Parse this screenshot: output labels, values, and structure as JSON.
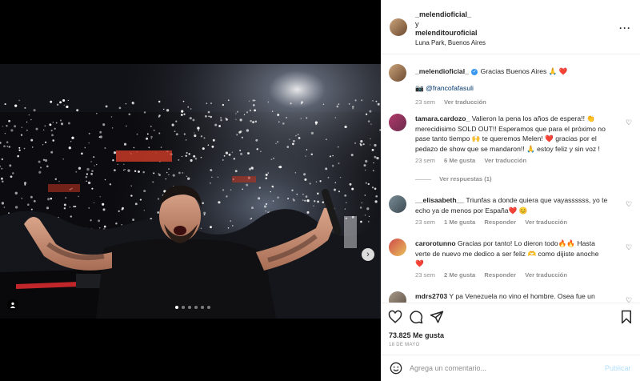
{
  "post": {
    "header": {
      "user1": "_melendioficial_",
      "joiner": "y",
      "user2": "melenditouroficial",
      "location": "Luna Park, Buenos Aires"
    },
    "caption": {
      "user": "_melendioficial_",
      "text": "Gracias Buenos Aires 🙏 ❤️",
      "credit_prefix": "📷",
      "credit_user": "@francofafasuli",
      "age": "23 sem",
      "translate": "Ver traducción"
    },
    "comments": [
      {
        "user": "tamara.cardozo_",
        "lines": [
          "Valieron la pena los años de espera!! 👏",
          "merecidisimo SOLD OUT!! Esperamos que para el próximo no",
          "pase tanto tiempo 🙌 te queremos Melen! ❤️ gracias por el",
          "pedazo de show que se mandaron!! 🙏 estoy feliz y sin voz !"
        ],
        "age": "23 sem",
        "likes": "6 Me gusta",
        "translate": "Ver traducción",
        "replies": "Ver respuestas (1)"
      },
      {
        "user": "__elisaabeth__",
        "lines": [
          "Triunfas a donde quiera que vayassssss, yo te",
          "echo ya de menos por España❤️ 😊"
        ],
        "age": "23 sem",
        "likes": "1 Me gusta",
        "reply": "Responder",
        "translate": "Ver traducción"
      },
      {
        "user": "carorotunno",
        "lines": [
          "Gracias por tanto! Lo dieron todo🔥🔥 Hasta",
          "verte de nuevo me dedico a ser feliz 🫶 como dijiste anoche",
          "❤️"
        ],
        "age": "23 sem",
        "likes": "2 Me gusta",
        "reply": "Responder",
        "translate": "Ver traducción"
      },
      {
        "user": "mdrs2703",
        "lines": [
          "Y pa Venezuela no vino el hombre. Osea fue un"
        ]
      }
    ],
    "likes_count": "73.825 Me gusta",
    "date": "18 DE MAYO",
    "comment_input": {
      "placeholder": "Agrega un comentario...",
      "value": ""
    },
    "publish_label": "Publicar",
    "carousel": {
      "count": 6,
      "active": 0
    },
    "colors": {
      "verified": "#3897f0",
      "link": "#00376b",
      "publish_disabled": "#b2dffc",
      "like_red": "#ed4956"
    },
    "icons": {
      "header_more": "more-horizontal-icon",
      "like": "heart-outline-icon",
      "comment": "comment-bubble-icon",
      "share": "paper-plane-icon",
      "save": "bookmark-icon",
      "emoji": "smiley-icon",
      "tag": "user-tag-icon",
      "next": "chevron-right-icon",
      "more_horizontal_glyph": "···"
    }
  }
}
